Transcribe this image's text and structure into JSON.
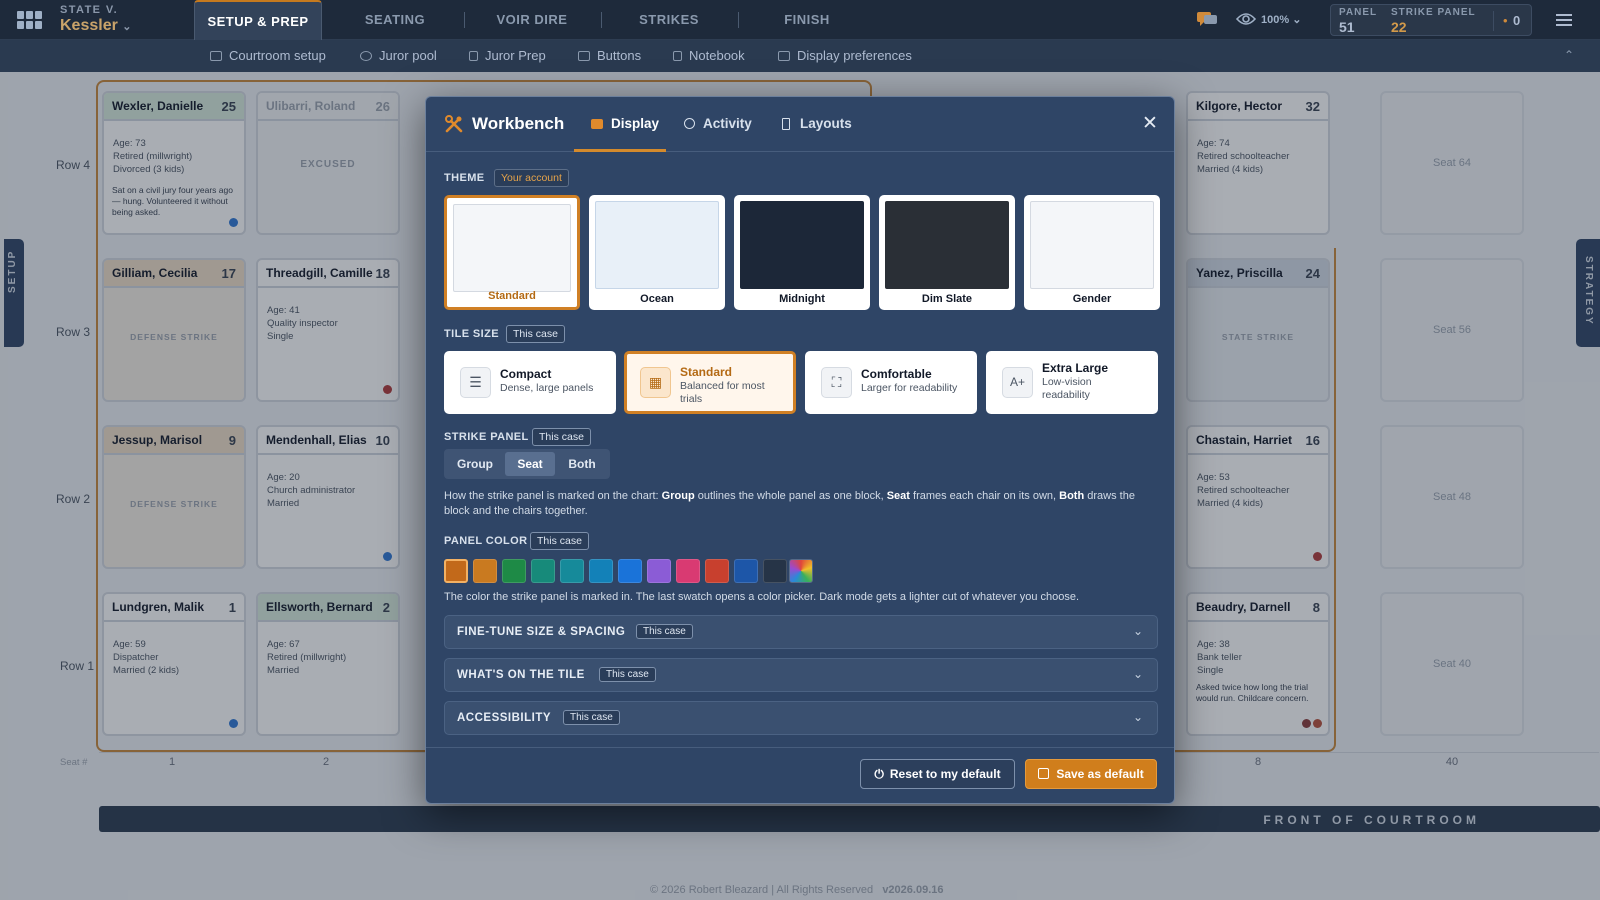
{
  "header": {
    "case_small": "STATE V.",
    "case_name": "Kessler",
    "case_chevron": "⌄",
    "tabs": [
      {
        "label": "SETUP & PREP"
      },
      {
        "label": "SEATING"
      },
      {
        "label": "VOIR DIRE"
      },
      {
        "label": "STRIKES"
      },
      {
        "label": "FINISH"
      }
    ],
    "zoom": "100%",
    "panel_label": "PANEL",
    "panel_value": "51",
    "strike_label": "STRIKE PANEL",
    "strike_value": "22",
    "bullet": "•",
    "count": "0"
  },
  "subnav": {
    "items": [
      {
        "label": "Courtroom setup"
      },
      {
        "label": "Juror pool"
      },
      {
        "label": "Juror Prep"
      },
      {
        "label": "Buttons"
      },
      {
        "label": "Notebook"
      },
      {
        "label": "Display preferences"
      }
    ],
    "collapse_glyph": "⌃"
  },
  "side_tabs": {
    "left": "SETUP",
    "right": "STRATEGY"
  },
  "rows": [
    "Row 4",
    "Row 3",
    "Row 2",
    "Row 1"
  ],
  "seat_hash": "Seat #",
  "seat_numbers": [
    "1",
    "2",
    "8",
    "40"
  ],
  "front": "FRONT OF COURTROOM",
  "seats": {
    "wexler": {
      "name": "Wexler, Danielle",
      "no": "25",
      "info": [
        "Age: 73",
        "Retired (millwright)",
        "Divorced (3 kids)"
      ],
      "note": "Sat on a civil jury four years ago — hung. Volunteered it without being asked."
    },
    "ulibarri": {
      "name": "Ulibarri, Roland",
      "no": "26",
      "tag": "EXCUSED"
    },
    "kilgore": {
      "name": "Kilgore, Hector",
      "no": "32",
      "info": [
        "Age: 74",
        "Retired schoolteacher",
        "Married (4 kids)"
      ]
    },
    "gilliam": {
      "name": "Gilliam, Cecilia",
      "no": "17",
      "tag": "DEFENSE STRIKE"
    },
    "threadgill": {
      "name": "Threadgill, Camille",
      "no": "18",
      "info": [
        "Age: 41",
        "Quality inspector",
        "Single"
      ]
    },
    "yanez": {
      "name": "Yanez, Priscilla",
      "no": "24",
      "tag": "STATE STRIKE"
    },
    "jessup": {
      "name": "Jessup, Marisol",
      "no": "9",
      "tag": "DEFENSE STRIKE"
    },
    "mendenhall": {
      "name": "Mendenhall, Elias",
      "no": "10",
      "info": [
        "Age: 20",
        "Church administrator",
        "Married"
      ]
    },
    "chastain": {
      "name": "Chastain, Harriet",
      "no": "16",
      "info": [
        "Age: 53",
        "Retired schoolteacher",
        "Married (4 kids)"
      ]
    },
    "lundgren": {
      "name": "Lundgren, Malik",
      "no": "1",
      "info": [
        "Age: 59",
        "Dispatcher",
        "Married (2 kids)"
      ]
    },
    "ellsworth": {
      "name": "Ellsworth, Bernard",
      "no": "2",
      "info": [
        "Age: 67",
        "Retired (millwright)",
        "Married"
      ]
    },
    "beaudry": {
      "name": "Beaudry, Darnell",
      "no": "8",
      "info": [
        "Age: 38",
        "Bank teller",
        "Single"
      ],
      "note": "Asked twice how long the trial would run. Childcare concern."
    }
  },
  "empty_seats": [
    "Seat 64",
    "Seat 56",
    "Seat 48",
    "Seat 40"
  ],
  "footer": {
    "copyright": "© 2026 Robert Bleazard | All Rights Reserved",
    "version": "v2026.09.16"
  },
  "modal": {
    "title": "Workbench",
    "tabs": [
      {
        "label": "Display"
      },
      {
        "label": "Activity"
      },
      {
        "label": "Layouts"
      }
    ],
    "close": "✕",
    "theme": {
      "label": "THEME",
      "scope": "Your account",
      "options": [
        {
          "label": "Standard",
          "preview_bg": "#f4f6f9"
        },
        {
          "label": "Ocean",
          "preview_bg": "#e8f0f8"
        },
        {
          "label": "Midnight",
          "preview_bg": "#1c2738"
        },
        {
          "label": "Dim Slate",
          "preview_bg": "#2a2f36"
        },
        {
          "label": "Gender",
          "preview_bg": "#f4f6f9"
        }
      ]
    },
    "tile_size": {
      "label": "TILE SIZE",
      "scope": "This case",
      "options": [
        {
          "title": "Compact",
          "sub": "Dense, large panels",
          "glyph": "☰"
        },
        {
          "title": "Standard",
          "sub": "Balanced for most trials",
          "glyph": "▦"
        },
        {
          "title": "Comfortable",
          "sub": "Larger for readability",
          "glyph": "⛶"
        },
        {
          "title": "Extra Large",
          "sub": "Low-vision readability",
          "glyph": "A+"
        }
      ]
    },
    "strike_panel": {
      "label": "STRIKE PANEL",
      "scope": "This case",
      "options": [
        "Group",
        "Seat",
        "Both"
      ],
      "selected": "Seat",
      "desc_1": "How the strike panel is marked on the chart: ",
      "desc_group": "Group",
      "desc_2": " outlines the whole panel as one block, ",
      "desc_seat": "Seat",
      "desc_3": " frames each chair on its own, ",
      "desc_both": "Both",
      "desc_4": " draws the block and the chairs together."
    },
    "panel_color": {
      "label": "PANEL COLOR",
      "scope": "This case",
      "swatches": [
        "#c2691a",
        "#c97a20",
        "#1e8a46",
        "#178a7a",
        "#168a9a",
        "#1381b8",
        "#1a73d9",
        "#8b5cd6",
        "#d93a72",
        "#c8402e",
        "#1d56a8",
        "#263447"
      ],
      "desc": "The color the strike panel is marked in. The last swatch opens a color picker. Dark mode gets a lighter cut of whatever you choose."
    },
    "accordions": [
      {
        "title": "FINE-TUNE SIZE & SPACING",
        "scope": "This case"
      },
      {
        "title": "WHAT'S ON THE TILE",
        "scope": "This case"
      },
      {
        "title": "ACCESSIBILITY",
        "scope": "This case"
      }
    ],
    "reset_label": "Reset to my default",
    "save_label": "Save as default"
  }
}
